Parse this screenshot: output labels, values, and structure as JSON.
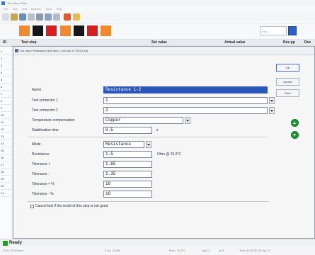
{
  "window": {
    "title": "Test Step Editor",
    "menu": [
      "File",
      "Edit",
      "Test",
      "Options",
      "Tools",
      "Help"
    ]
  },
  "ribbon": {
    "combo_value": "Par 1"
  },
  "grid": {
    "columns": [
      "ID",
      "Test step",
      "Set value",
      "Actual value",
      "Res pp",
      "Res"
    ],
    "left_ids": [
      "1",
      "2",
      "3",
      "4",
      "5",
      "6",
      "7",
      "8",
      "9",
      "10",
      "11",
      "12",
      "13",
      "14",
      "15",
      "16",
      "17",
      "18",
      "19",
      "20",
      "21"
    ]
  },
  "dialog": {
    "title": "Set value Resistance test Step 1 (05-Apr-17 08:01:18)",
    "fields": {
      "name_label": "Name",
      "name_value": "Resistance 1-2",
      "tc1_label": "Test connector 1",
      "tc1_value": "1",
      "tc2_label": "Test connector 2",
      "tc2_value": "2",
      "temp_label": "Temperature compensation",
      "temp_value": "Copper",
      "stab_label": "Stabilization time",
      "stab_value": "0.5",
      "stab_unit": "s",
      "mode_label": "Mode",
      "mode_value": "Resistance",
      "res_label": "Resistance",
      "res_value": "1.5",
      "res_unit": "Ohm @ 20.0°C",
      "tolp_label": "Tolerance +",
      "tolp_value": "1.65",
      "tolm_label": "Tolerance -",
      "tolm_value": "1.35",
      "tolpp_label": "Tolerance + %",
      "tolpp_value": "10",
      "tolmp_label": "Tolerance - %",
      "tolmp_value": "10",
      "cancel_label": "Cancel test if the result of this step is not good"
    },
    "buttons": {
      "ok": "OK",
      "cancel": "Cancel",
      "print": "Print"
    }
  },
  "status": {
    "ready": "Ready",
    "items": [
      "0000 STVPower",
      "0 No. 01188",
      "Temp. 20.0°C",
      "ngb 12",
      "pt 5",
      "Time 00:00:00 05-Apr-17"
    ]
  },
  "colors": {
    "accent_orange": "#f08a2c",
    "accent_red": "#d81f1f",
    "selection_blue": "#2b58b8",
    "go_green": "#1e9a34"
  }
}
